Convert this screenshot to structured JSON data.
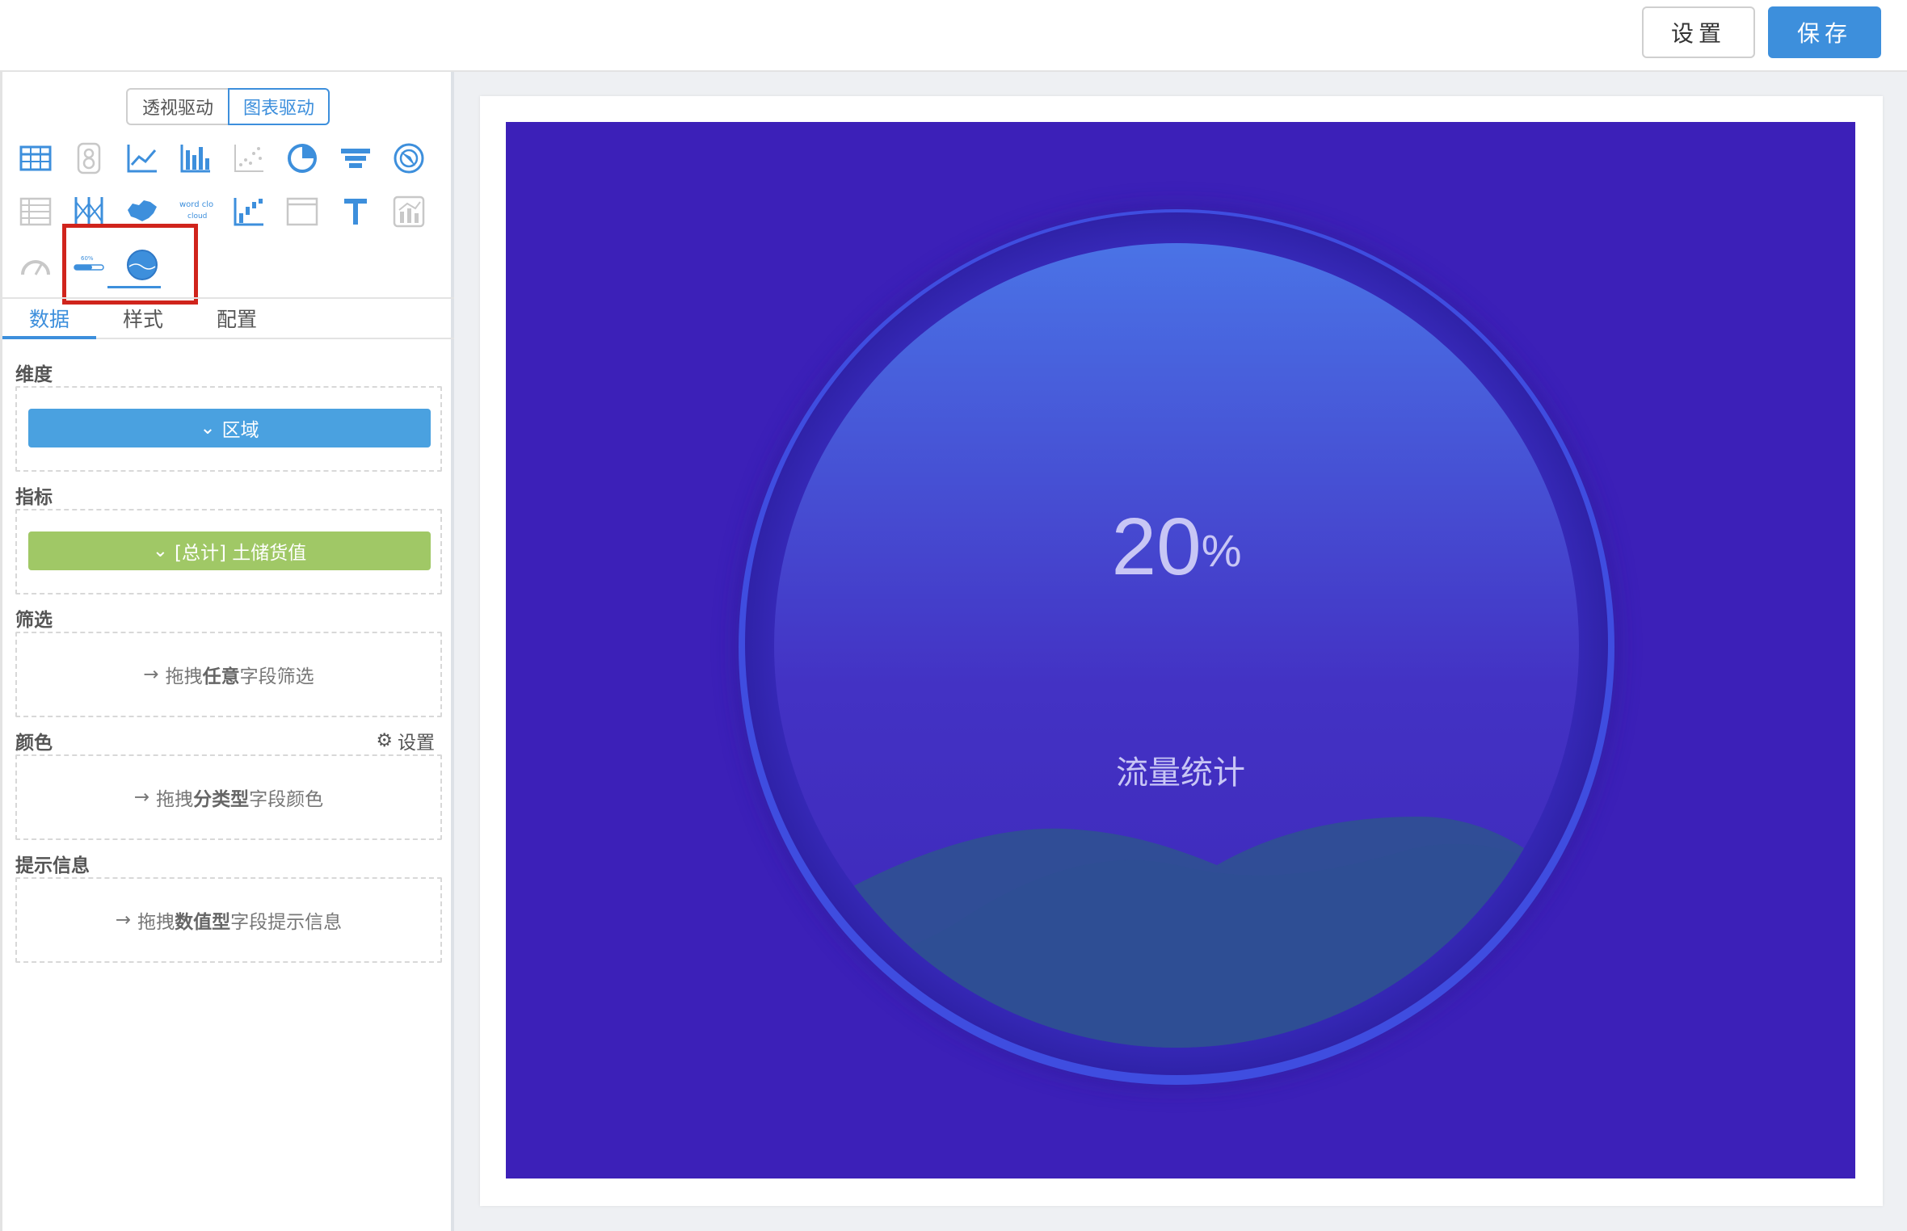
{
  "topbar": {
    "settings_label": "设置",
    "save_label": "保存"
  },
  "sidebar": {
    "mode_left": "透视驱动",
    "mode_right": "图表驱动",
    "tabs": [
      {
        "label": "数据",
        "active": true
      },
      {
        "label": "样式",
        "active": false
      },
      {
        "label": "配置",
        "active": false
      }
    ],
    "sections": {
      "dimension": {
        "label": "维度",
        "field": "区域"
      },
      "measure": {
        "label": "指标",
        "field": "[总计] 土储货值"
      },
      "filter": {
        "label": "筛选",
        "hint_prefix": "拖拽",
        "hint_bold": "任意",
        "hint_suffix": "字段筛选"
      },
      "color": {
        "label": "颜色",
        "setting": "设置",
        "hint_prefix": "拖拽",
        "hint_bold": "分类型",
        "hint_suffix": "字段颜色"
      },
      "tooltip": {
        "label": "提示信息",
        "hint_prefix": "拖拽",
        "hint_bold": "数值型",
        "hint_suffix": "字段提示信息"
      }
    },
    "chart_icons": [
      "table-icon",
      "number-card-icon",
      "line-chart-icon",
      "bar-chart-icon",
      "scatter-icon",
      "pie-chart-icon",
      "funnel-icon",
      "radar-icon",
      "cross-table-icon",
      "parallel-icon",
      "china-map-icon",
      "word-cloud-icon",
      "waterfall-icon",
      "frame-icon",
      "text-icon",
      "combo-chart-icon",
      "gauge-icon",
      "progress-bar-icon",
      "liquid-fill-icon"
    ],
    "word_cloud_text": "word cloud",
    "progress_icon_text": "60%",
    "selected_icon": "liquid-fill-icon"
  },
  "widget": {
    "value_number": "20",
    "value_unit": "%",
    "label": "流量统计",
    "colors": {
      "background": "#3c20b8",
      "ball_top": "#4a73e6",
      "ball_bottom": "#3d27b8",
      "wave": "#2f4f93",
      "ring": "#3f4de0"
    }
  }
}
